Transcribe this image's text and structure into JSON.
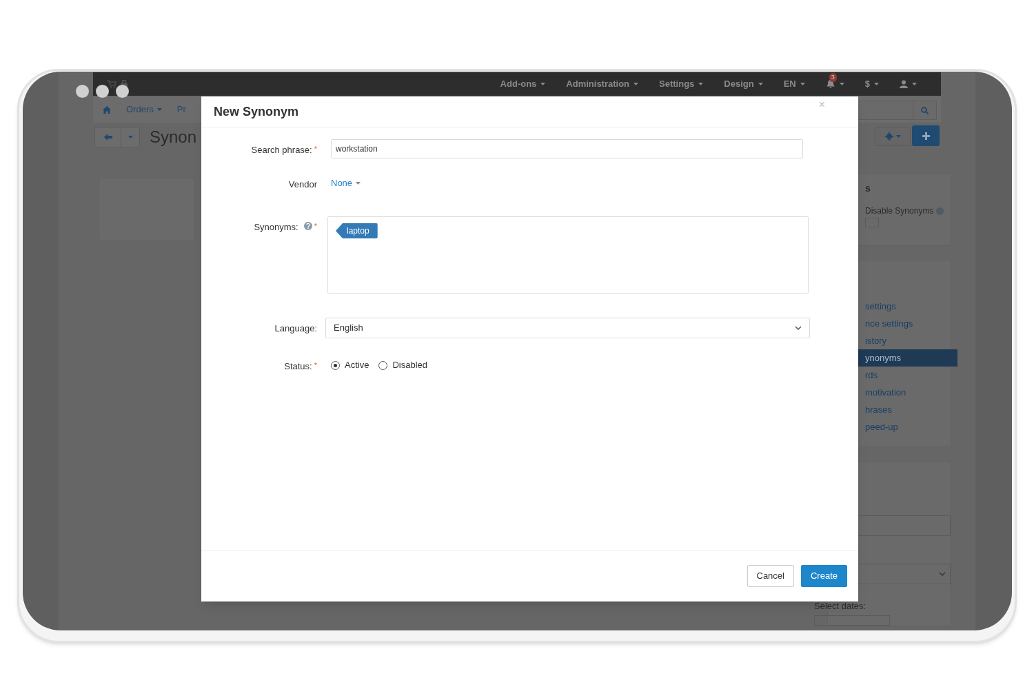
{
  "top_nav": {
    "items": [
      {
        "label": "Add-ons",
        "kind": "text"
      },
      {
        "label": "Administration",
        "kind": "text"
      },
      {
        "label": "Settings",
        "kind": "text"
      },
      {
        "label": "Design",
        "kind": "text"
      },
      {
        "label": "EN",
        "kind": "text"
      },
      {
        "label": "3",
        "kind": "bell"
      },
      {
        "label": "$",
        "kind": "text"
      },
      {
        "kind": "user"
      }
    ]
  },
  "secondary_nav": {
    "items": [
      "Orders",
      "Pr"
    ]
  },
  "page_title": "Synon",
  "settings_panel": {
    "heading": "s",
    "option": "Disable Synonyms"
  },
  "sidebar_menu": [
    {
      "label": "settings",
      "selected": false
    },
    {
      "label": "nce settings",
      "selected": false
    },
    {
      "label": "istory",
      "selected": false
    },
    {
      "label": "ynonyms",
      "selected": true
    },
    {
      "label": "rds",
      "selected": false
    },
    {
      "label": "motivation",
      "selected": false
    },
    {
      "label": "hrases",
      "selected": false
    },
    {
      "label": "peed-up",
      "selected": false
    }
  ],
  "filter_panel": {
    "label": "Select dates:"
  },
  "modal": {
    "title": "New Synonym",
    "close": "×",
    "fields": [
      {
        "kind": "text",
        "label": "Search phrase:",
        "required_mark": "*",
        "value": "workstation"
      },
      {
        "kind": "link-select",
        "label": "Vendor",
        "value": "None"
      },
      {
        "kind": "tags",
        "label": "Synonyms:",
        "required_mark": "*",
        "tags": [
          "laptop"
        ]
      },
      {
        "kind": "select",
        "label": "Language:",
        "value": "English"
      },
      {
        "kind": "radio",
        "label": "Status:",
        "required_mark": "*",
        "options": [
          {
            "label": "Active",
            "selected": true
          },
          {
            "label": "Disabled",
            "selected": false
          }
        ]
      }
    ],
    "buttons": [
      {
        "label": "Cancel",
        "kind": "secondary"
      },
      {
        "label": "Create",
        "kind": "primary"
      }
    ]
  }
}
